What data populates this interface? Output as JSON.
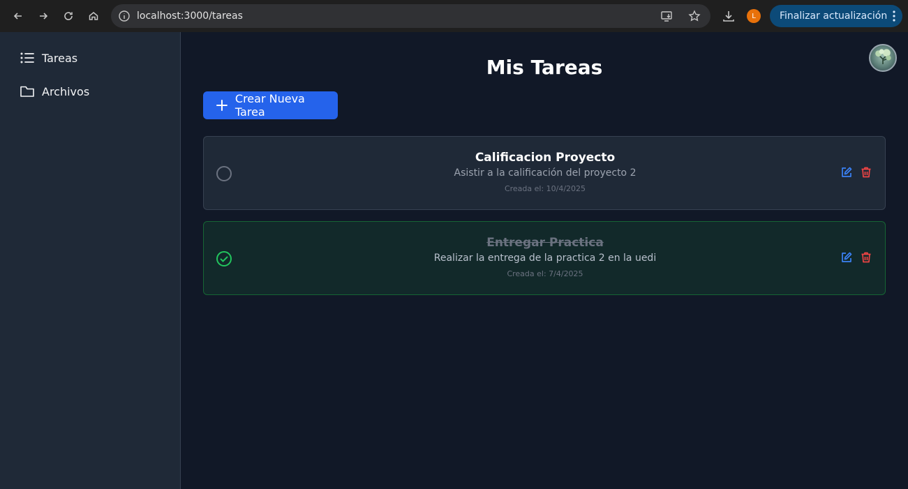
{
  "browser": {
    "url": "localhost:3000/tareas",
    "profile_initial": "L",
    "update_label": "Finalizar actualización"
  },
  "sidebar": {
    "items": [
      {
        "label": "Tareas",
        "icon": "list-icon"
      },
      {
        "label": "Archivos",
        "icon": "folder-icon"
      }
    ]
  },
  "main": {
    "title": "Mis Tareas",
    "create_label": "Crear Nueva Tarea"
  },
  "tasks": [
    {
      "title": "Calificacion Proyecto",
      "description": "Asistir a la calificación del proyecto 2",
      "created": "Creada el: 10/4/2025",
      "completed": false
    },
    {
      "title": "Entregar Practica",
      "description": "Realizar la entrega de la practica 2 en la uedi",
      "created": "Creada el: 7/4/2025",
      "completed": true
    }
  ],
  "colors": {
    "accent": "#2563eb",
    "edit": "#3b82f6",
    "delete": "#ef4444",
    "done": "#22c55e"
  }
}
